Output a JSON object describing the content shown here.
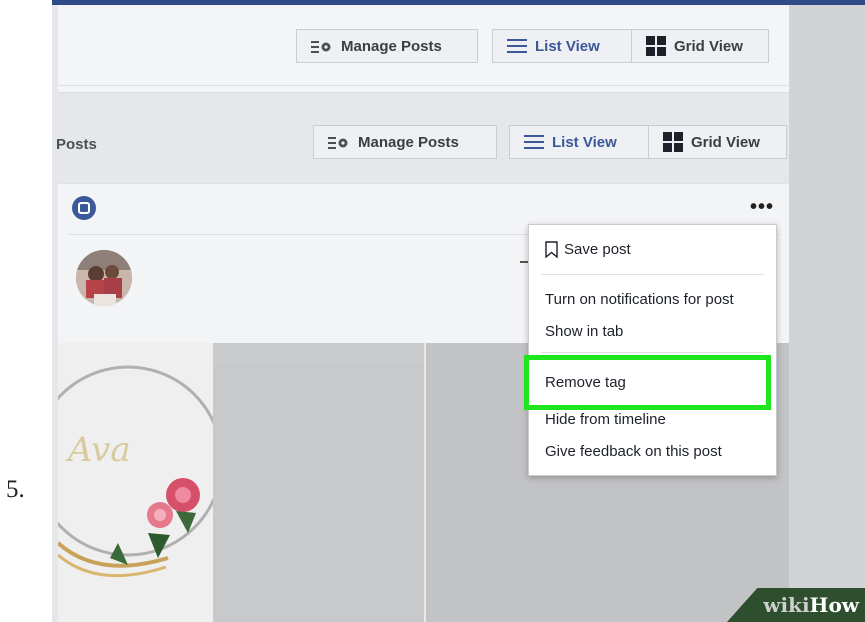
{
  "step_number": "5.",
  "toolbar_top": {
    "manage_posts": "Manage Posts",
    "list_view": "List View",
    "grid_view": "Grid View"
  },
  "toolbar_posts": {
    "label": "Posts",
    "manage_posts": "Manage Posts",
    "list_view": "List View",
    "grid_view": "Grid View"
  },
  "post": {
    "more_menu": "•••"
  },
  "context_menu": {
    "items": [
      "Save post",
      "Turn on notifications for post",
      "Show in tab",
      "Remove tag",
      "Hide from timeline",
      "Give feedback on this post"
    ],
    "highlighted_item": "Remove tag"
  },
  "photo_caption": "Ava",
  "watermark": {
    "wiki": "wiki",
    "how": "How"
  },
  "colors": {
    "facebook_blue": "#3b5998",
    "highlight_green": "#1ee61e",
    "watermark_bg": "#2d4f2e"
  }
}
